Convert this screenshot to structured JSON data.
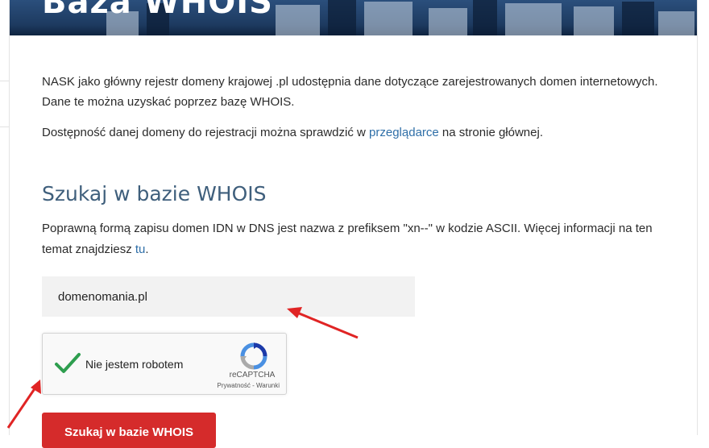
{
  "hero": {
    "title": "Baza WHOIS"
  },
  "intro": {
    "line1": "NASK jako główny rejestr domeny krajowej .pl udostępnia dane dotyczące zarejestrowanych domen internetowych.",
    "line2": "Dane te można uzyskać poprzez bazę WHOIS.",
    "line3_before": "Dostępność danej domeny do rejestracji można sprawdzić w ",
    "line3_link": "przeglądarce",
    "line3_after": " na stronie głównej."
  },
  "search": {
    "heading": "Szukaj w bazie WHOIS",
    "note_line1": "Poprawną formą zapisu domen IDN w DNS jest nazwa z prefiksem \"xn--\" w kodzie ASCII. Więcej informacji na ten",
    "note_line2_before": "temat znajdziesz ",
    "note_line2_link": "tu",
    "note_line2_after": ".",
    "input_value": "domenomania.pl",
    "submit_label": "Szukaj w bazie WHOIS"
  },
  "captcha": {
    "label": "Nie jestem robotem",
    "brand": "reCAPTCHA",
    "terms": "Prywatność - Warunki",
    "checked": true
  },
  "colors": {
    "accent_link": "#2f6fa8",
    "heading": "#3f5f7c",
    "submit": "#d52b2b",
    "annotation_arrow": "#e02424",
    "check": "#2e9e4f"
  }
}
